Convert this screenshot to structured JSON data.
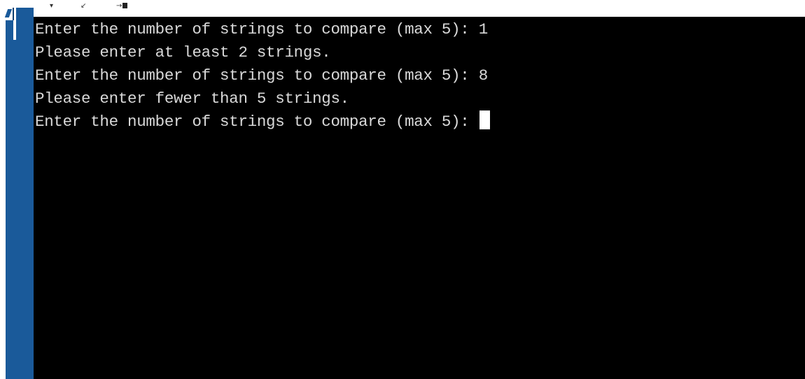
{
  "toolbar": {
    "icons": [
      "chevron-down-icon",
      "arrow-icon",
      "login-icon"
    ],
    "glyph_1": "▾",
    "glyph_2": "↙",
    "glyph_3": "→"
  },
  "colors": {
    "terminal_background": "#000000",
    "terminal_text": "#d9d9d9",
    "sidebar": "#1a5a9a",
    "cursor": "#ffffff"
  },
  "terminal": {
    "lines": [
      "Enter the number of strings to compare (max 5): 1",
      "Please enter at least 2 strings.",
      "Enter the number of strings to compare (max 5): 8",
      "Please enter fewer than 5 strings.",
      "Enter the number of strings to compare (max 5): "
    ]
  }
}
